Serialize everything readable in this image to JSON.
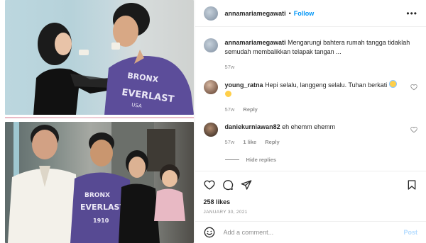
{
  "post": {
    "username": "annamariamegawati",
    "follow_label": "Follow",
    "dot": "•",
    "more": "•••"
  },
  "caption": {
    "username": "annamariamegawati",
    "text": "Mengarungi bahtera rumah tangga tidaklah semudah membalikkan telapak tangan ...",
    "age": "57w"
  },
  "comments": [
    {
      "username": "young_ratna",
      "text": "Hepi selalu, langgeng selalu. Tuhan berkati",
      "age": "57w",
      "reply": "Reply",
      "likes": ""
    },
    {
      "username": "daniekurniawan82",
      "text": "eh ehemm ehemm",
      "age": "57w",
      "likes": "1 like",
      "reply": "Reply"
    }
  ],
  "hide_replies": "Hide replies",
  "stats": {
    "likes": "258 likes",
    "date": "JANUARY 30, 2021"
  },
  "add_comment": {
    "placeholder": "Add a comment...",
    "post_label": "Post"
  },
  "photo_text": {
    "shirt_line1": "BRONX",
    "shirt_line2": "EVERLAST",
    "shirt_line3": "USA",
    "shirt_line4": "1910"
  },
  "colors": {
    "accent": "#0095f6",
    "post_disabled": "#b3dbff",
    "muted": "#8e8e8e"
  }
}
